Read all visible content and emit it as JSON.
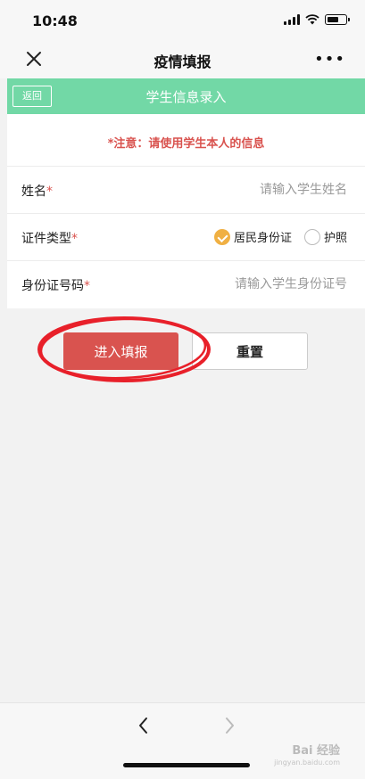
{
  "status_bar": {
    "time": "10:48",
    "battery_level": 0.7
  },
  "nav": {
    "title": "疫情填报",
    "more": "•••"
  },
  "header": {
    "back_label": "返回",
    "title": "学生信息录入"
  },
  "form": {
    "notice": "*注意：请使用学生本人的信息",
    "name": {
      "label": "姓名",
      "required": "*",
      "placeholder": "请输入学生姓名"
    },
    "id_type": {
      "label": "证件类型",
      "required": "*",
      "options": [
        {
          "label": "居民身份证",
          "checked": true
        },
        {
          "label": "护照",
          "checked": false
        }
      ]
    },
    "id_number": {
      "label": "身份证号码",
      "required": "*",
      "placeholder": "请输入学生身份证号"
    }
  },
  "buttons": {
    "submit": "进入填报",
    "reset": "重置"
  },
  "watermark": {
    "text": "Bai 经验",
    "sub": "jingyan.baidu.com"
  },
  "colors": {
    "accent_green": "#72d8a6",
    "primary_red": "#d9534f",
    "radio_checked": "#f0b043",
    "annotation_ring": "#e8202a"
  }
}
